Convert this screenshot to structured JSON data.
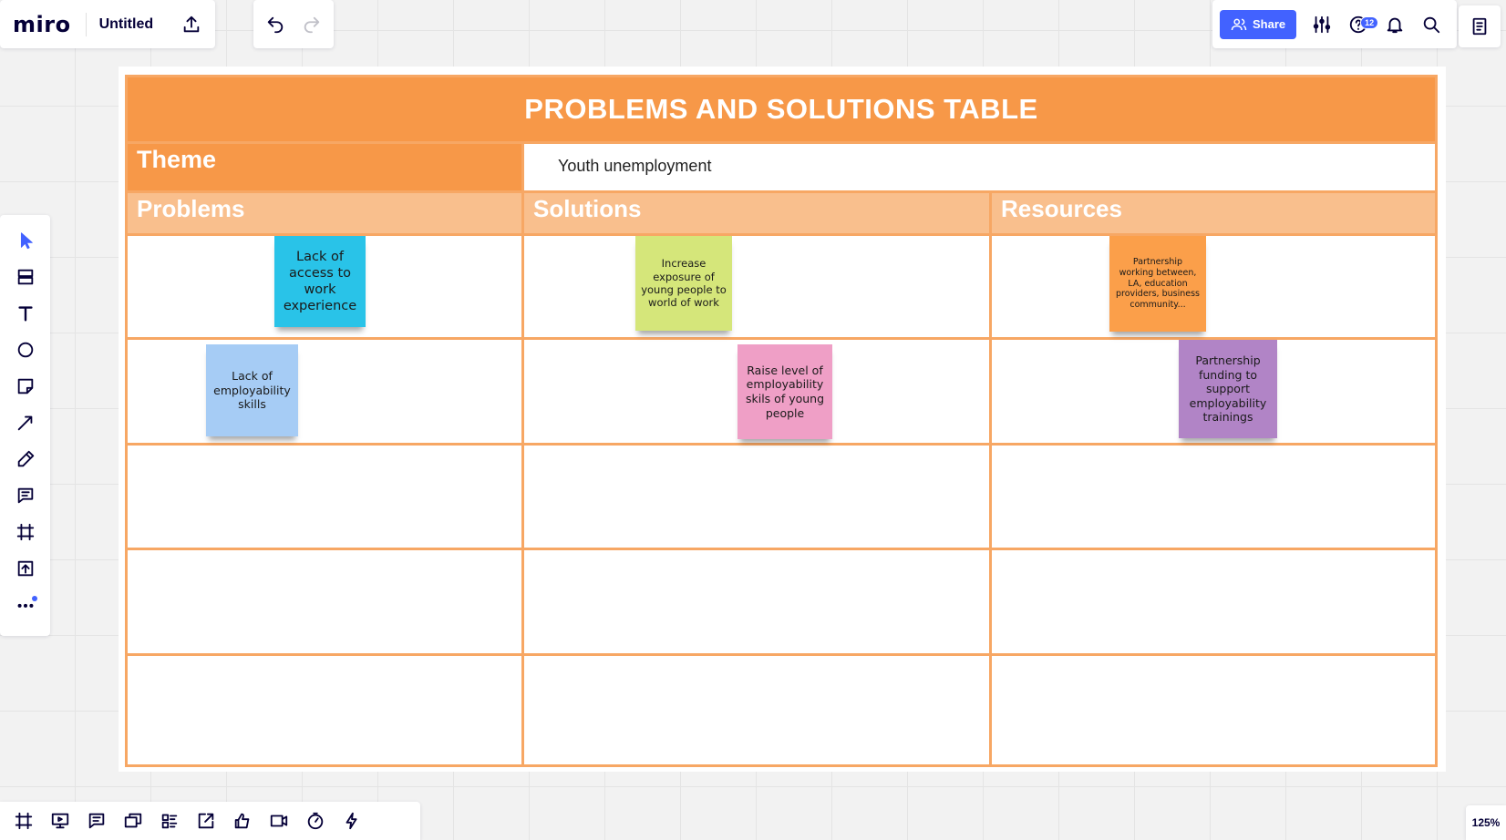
{
  "app": {
    "logo": "miro",
    "board_title": "Untitled"
  },
  "header": {
    "share_label": "Share",
    "notifications_badge": "12"
  },
  "zoom": "125%",
  "table": {
    "title": "PROBLEMS AND SOLUTIONS TABLE",
    "theme_label": "Theme",
    "theme_value": "Youth unemployment",
    "columns": [
      "Problems",
      "Solutions",
      "Resources"
    ]
  },
  "stickies": [
    {
      "text": "Lack of access to work experience",
      "color": "#29c3e8"
    },
    {
      "text": "Increase exposure of young people to world of work",
      "color": "#d5e67a"
    },
    {
      "text": "Partnership working between, LA, education providers, business community...",
      "color": "#fb9f4a"
    },
    {
      "text": "Lack of employability skills",
      "color": "#a6ccf5"
    },
    {
      "text": "Raise level of employability skils of young people",
      "color": "#ef9fc6"
    },
    {
      "text": "Partnership funding to support employability trainings",
      "color": "#b184c6"
    }
  ],
  "icons": {
    "left_toolbar": [
      "select-icon",
      "templates-icon",
      "text-icon",
      "shape-icon",
      "sticky-note-icon",
      "connection-line-icon",
      "pen-icon",
      "comment-icon",
      "frame-icon",
      "upload-icon",
      "more-icon"
    ],
    "bottom_toolbar": [
      "frames-icon",
      "presentation-icon",
      "comments-icon",
      "video-chat-icon",
      "card-list-icon",
      "screen-share-icon",
      "voting-icon",
      "video-icon",
      "timer-icon",
      "activity-icon"
    ]
  }
}
